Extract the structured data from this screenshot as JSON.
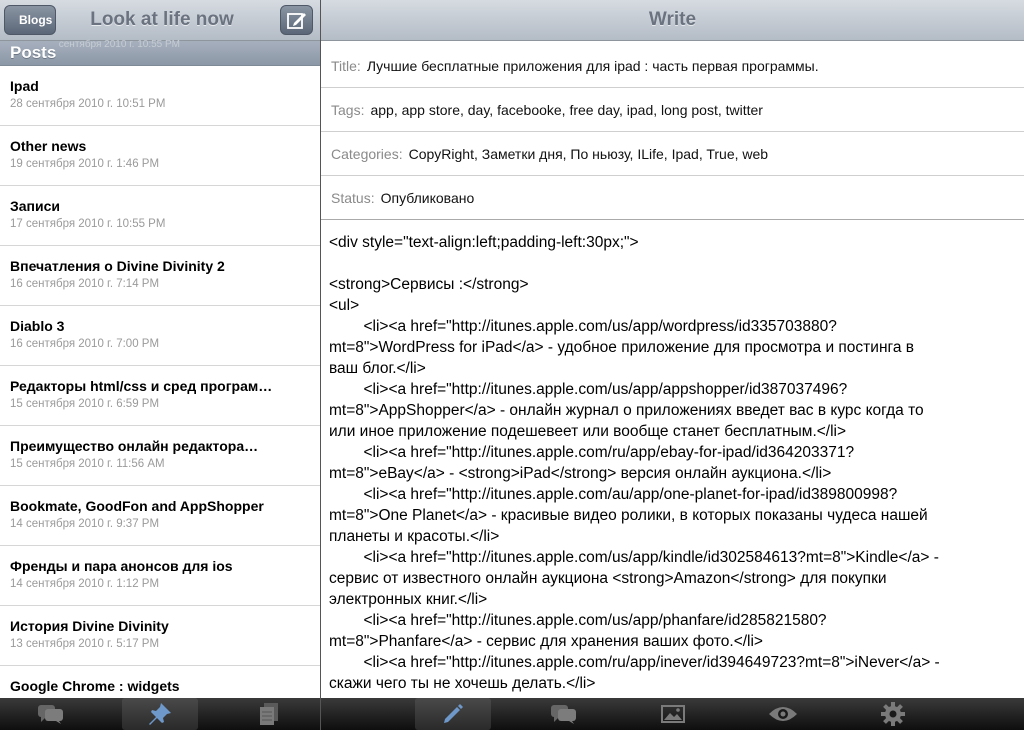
{
  "left": {
    "back_label": "Blogs",
    "title": "Look at life now",
    "section_title": "Posts",
    "section_faded_text": "сентября 2010 г. 10:55 PM",
    "posts": [
      {
        "title": "Ipad",
        "date": "28 сентября 2010 г. 10:51 PM"
      },
      {
        "title": "Other news",
        "date": "19 сентября 2010 г. 1:46 PM"
      },
      {
        "title": "Записи",
        "date": "17 сентября 2010 г. 10:55 PM"
      },
      {
        "title": "Впечатления о Divine Divinity 2",
        "date": "16 сентября 2010 г. 7:14 PM"
      },
      {
        "title": "Diablo 3",
        "date": "16 сентября 2010 г. 7:00 PM"
      },
      {
        "title": "Редакторы html/css и сред програм…",
        "date": "15 сентября 2010 г. 6:59 PM"
      },
      {
        "title": "Преимущество онлайн редактора…",
        "date": "15 сентября 2010 г. 11:56 AM"
      },
      {
        "title": "Bookmate, GoodFon and AppShopper",
        "date": "14 сентября 2010 г. 9:37 PM"
      },
      {
        "title": "Френды и пара анонсов для ios",
        "date": "14 сентября 2010 г. 1:12 PM"
      },
      {
        "title": "История Divine Divinity",
        "date": "13 сентября 2010 г. 5:17 PM"
      },
      {
        "title": "Google Chrome : widgets",
        "date": ""
      }
    ],
    "toolbar_icons": [
      "comments-icon",
      "pin-icon",
      "pages-icon"
    ]
  },
  "right": {
    "title": "Write",
    "meta": {
      "title_label": "Title:",
      "title_value": "Лучшие бесплатные приложения для ipad : часть первая программы.",
      "tags_label": "Tags:",
      "tags_value": "app, app store, day, facebooke, free day, ipad, long post, twitter",
      "categories_label": "Categories:",
      "categories_value": "CopyRight, Заметки дня, По ньюзу, ILife, Ipad, True, web",
      "status_label": "Status:",
      "status_value": "Опубликовано"
    },
    "body_lines": [
      "<div style=\"text-align:left;padding-left:30px;\">",
      "",
      "<strong>Сервисы :</strong>",
      "<ul>",
      "        <li><a href=\"http://itunes.apple.com/us/app/wordpress/id335703880?",
      "mt=8\">WordPress for iPad</a> - удобное приложение для просмотра и постинга в",
      "ваш блог.</li>",
      "        <li><a href=\"http://itunes.apple.com/us/app/appshopper/id387037496?",
      "mt=8\">AppShopper</a> - онлайн журнал о приложениях введет вас в курс когда то",
      "или иное приложение подешевеет или вообще станет бесплатным.</li>",
      "        <li><a href=\"http://itunes.apple.com/ru/app/ebay-for-ipad/id364203371?",
      "mt=8\">eBay</a> - <strong>iPad</strong> версия онлайн аукциона.</li>",
      "        <li><a href=\"http://itunes.apple.com/au/app/one-planet-for-ipad/id389800998?",
      "mt=8\">One Planet</a> - красивые видео ролики, в которых показаны чудеса нашей",
      "планеты и красоты.</li>",
      "        <li><a href=\"http://itunes.apple.com/us/app/kindle/id302584613?mt=8\">Kindle</a> -",
      "сервис от известного онлайн аукциона <strong>Amazon</strong> для покупки",
      "электронных книг.</li>",
      "        <li><a href=\"http://itunes.apple.com/us/app/phanfare/id285821580?",
      "mt=8\">Phanfare</a> - сервис для хранения ваших фото.</li>",
      "        <li><a href=\"http://itunes.apple.com/ru/app/inever/id394649723?mt=8\">iNever</a> -",
      "скажи чего ты не хочешь делать.</li>"
    ],
    "toolbar_icons": [
      "pencil-icon",
      "comments-icon",
      "photo-icon",
      "eye-icon",
      "gear-icon"
    ]
  },
  "colors": {
    "nav_text": "#6b7380",
    "toolbar_bg": "#1a1a1a",
    "section_header": "#97a2b0"
  }
}
